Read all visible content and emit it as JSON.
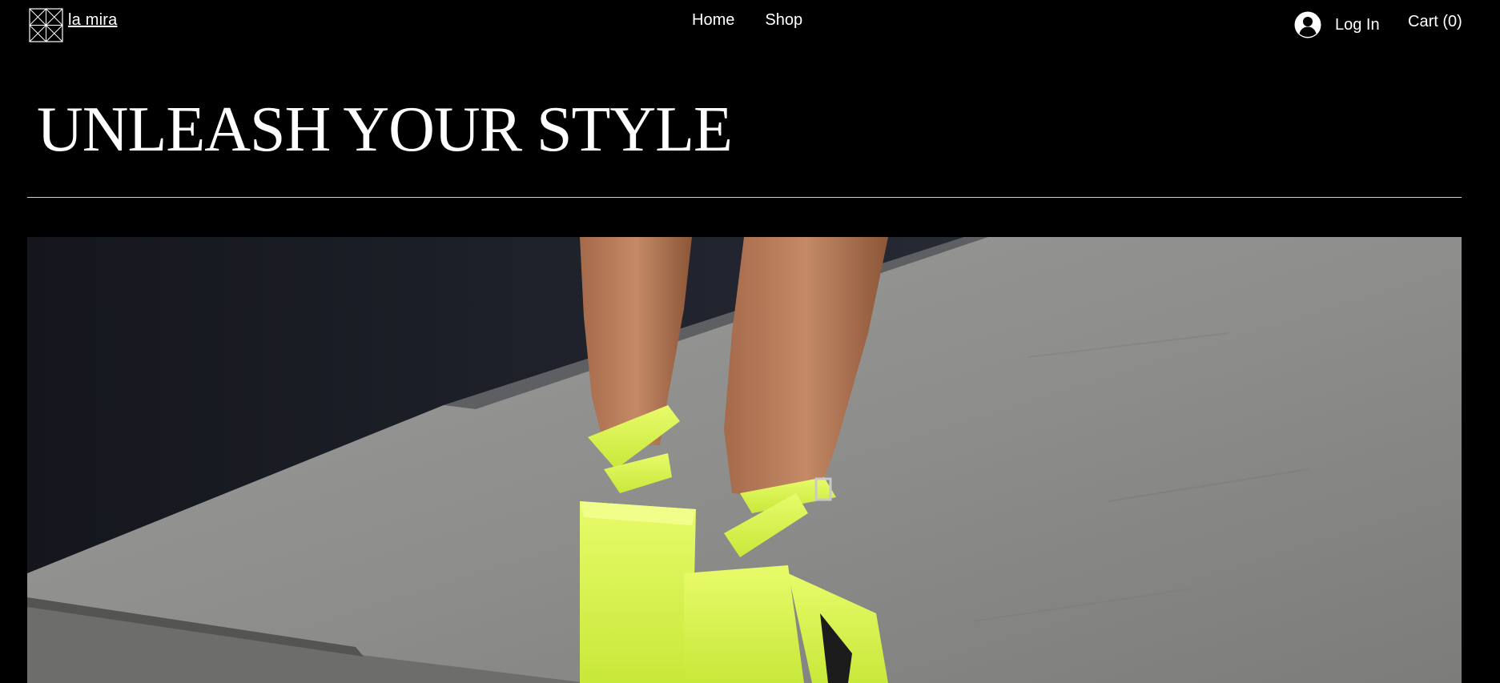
{
  "header": {
    "logo_text": "la mira",
    "nav": [
      {
        "label": "Home"
      },
      {
        "label": "Shop"
      }
    ],
    "login_label": "Log In",
    "cart_label": "Cart (0)"
  },
  "hero": {
    "title": "UNLEASH YOUR STYLE",
    "image_description_icon": "photo-heels-icon"
  },
  "colors": {
    "background": "#000000",
    "text": "#ffffff",
    "divider": "#cfcfcf",
    "accent_shoe": "#d9f542"
  }
}
